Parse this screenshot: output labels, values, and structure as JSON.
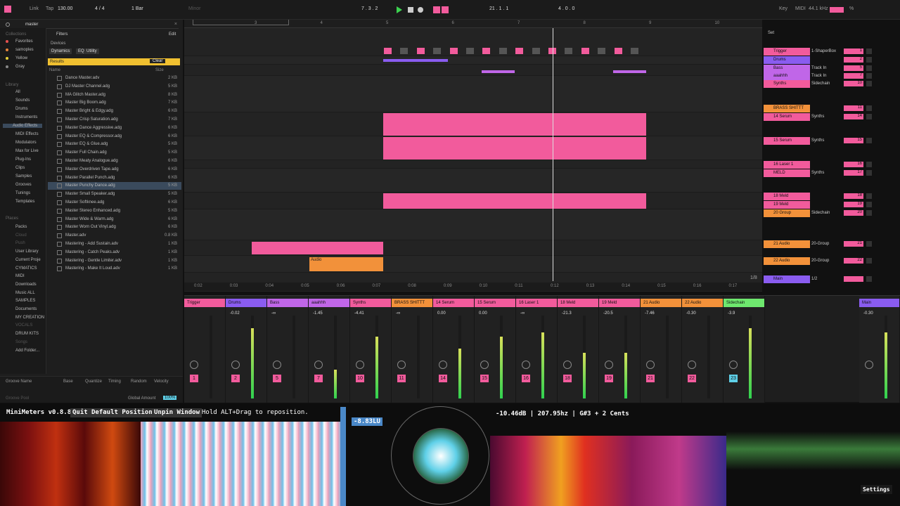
{
  "transport": {
    "link": "Link",
    "tap": "Tap",
    "tempo": "130.00",
    "signature": "4 / 4",
    "quantize": "1 Bar",
    "key_mode": "Minor",
    "position": "7 . 3 . 2",
    "loop_start": "21 . 1 . 1",
    "loop_length": "4 . 0 . 0",
    "key": "Key",
    "midi": "MIDI",
    "sample_rate": "44.1 kHz",
    "cpu": "%"
  },
  "browser": {
    "search": "master",
    "filters_label": "Filters",
    "edit_label": "Edit",
    "devices_label": "Devices",
    "tags": [
      "Dynamics",
      "EQ",
      "Utility"
    ],
    "results_label": "Results",
    "clear_label": "Clear",
    "col_name": "Name",
    "col_size": "Size",
    "collections_header": "Collections",
    "collections": [
      "Favorites",
      "samoples",
      "Yellow",
      "Gray"
    ],
    "collection_colors": [
      "#e85050",
      "#e8843a",
      "#e8d13a",
      "#888888"
    ],
    "library_header": "Library",
    "library": [
      "All",
      "Sounds",
      "Drums",
      "Instruments",
      "Audio Effects",
      "MIDI Effects",
      "Modulators",
      "Max for Live",
      "Plug-Ins",
      "Clips",
      "Samples",
      "Grooves",
      "Tunings",
      "Templates"
    ],
    "places_header": "Places",
    "places": [
      "Packs",
      "Cloud",
      "Push",
      "User Library",
      "Current Proje",
      "CYMATICS",
      "MIDI",
      "Downloads",
      "Music ALL",
      "SAMPLES",
      "Documents",
      "MY CREATION",
      "VOCALS",
      "DRUM KITS",
      "Songs",
      "Add Folder..."
    ],
    "files": [
      {
        "name": "Dance Master.adv",
        "size": "2 KB"
      },
      {
        "name": "DJ Master Channel.adg",
        "size": "5 KB"
      },
      {
        "name": "MA Glitch Master.adg",
        "size": "8 KB"
      },
      {
        "name": "Master Big Boom.adg",
        "size": "7 KB"
      },
      {
        "name": "Master Bright & Edgy.adg",
        "size": "6 KB"
      },
      {
        "name": "Master Crisp Saturation.adg",
        "size": "7 KB"
      },
      {
        "name": "Master Dance Aggressive.adg",
        "size": "6 KB"
      },
      {
        "name": "Master EQ & Compressor.adg",
        "size": "6 KB"
      },
      {
        "name": "Master EQ & Glue.adg",
        "size": "5 KB"
      },
      {
        "name": "Master Full Chain.adg",
        "size": "5 KB"
      },
      {
        "name": "Master Meaty Analogue.adg",
        "size": "6 KB"
      },
      {
        "name": "Master Overdriven Tape.adg",
        "size": "6 KB"
      },
      {
        "name": "Master Parallel Punch.adg",
        "size": "6 KB"
      },
      {
        "name": "Master Punchy Dance.adg",
        "size": "5 KB"
      },
      {
        "name": "Master Small Speaker.adg",
        "size": "5 KB"
      },
      {
        "name": "Master Softknee.adg",
        "size": "6 KB"
      },
      {
        "name": "Master Stereo Enhanced.adg",
        "size": "5 KB"
      },
      {
        "name": "Master Wide & Warm.adg",
        "size": "6 KB"
      },
      {
        "name": "Master Worn Out Vinyl.adg",
        "size": "6 KB"
      },
      {
        "name": "Master.adv",
        "size": "0.8 KB"
      },
      {
        "name": "Mastering - Add Sustain.adv",
        "size": "1 KB"
      },
      {
        "name": "Mastering - Catch Peaks.adv",
        "size": "1 KB"
      },
      {
        "name": "Mastering - Gentle Limiter.adv",
        "size": "1 KB"
      },
      {
        "name": "Mastering - Make It Loud.adv",
        "size": "1 KB"
      }
    ],
    "groove": {
      "name": "Groove Name",
      "base": "Base",
      "quantize": "Quantize",
      "timing": "Timing",
      "random": "Random",
      "velocity": "Velocity",
      "pool": "Groove Pool",
      "global_amount": "Global Amount",
      "global_value": "100%"
    }
  },
  "arrangement": {
    "bars": [
      "3",
      "4",
      "5",
      "6",
      "7",
      "8",
      "9",
      "10"
    ],
    "times": [
      "0:02",
      "0:03",
      "0:04",
      "0:05",
      "0:06",
      "0:07",
      "0:08",
      "0:09",
      "0:10",
      "0:11",
      "0:12",
      "0:13",
      "0:14",
      "0:15",
      "0:16",
      "0:17"
    ],
    "zoom": "1/8",
    "clip_audio": "Audio",
    "set_label": "Set"
  },
  "tracks": [
    {
      "name": "Trigger",
      "device": "1-ShaperBox",
      "num": "1",
      "color": "#f25b9c"
    },
    {
      "name": "Drums",
      "device": "",
      "num": "2",
      "color": "#8a5cf0"
    },
    {
      "name": "Bass",
      "device": "Track In",
      "num": "5",
      "color": "#c066e8"
    },
    {
      "name": "aaahhh",
      "device": "Track In",
      "num": "7",
      "color": "#c066e8"
    },
    {
      "name": "Synths",
      "device": "Sidechain",
      "num": "10",
      "color": "#f25b9c"
    },
    {
      "name": "BRASS SHITTT",
      "device": "",
      "num": "11",
      "color": "#f2913a"
    },
    {
      "name": "14 Serum",
      "device": "Synths",
      "num": "14",
      "color": "#f25b9c"
    },
    {
      "name": "15 Serum",
      "device": "Synths",
      "num": "15",
      "color": "#f25b9c"
    },
    {
      "name": "16 Laser 1",
      "device": "",
      "num": "16",
      "color": "#f25b9c"
    },
    {
      "name": "MELD",
      "device": "Synths",
      "num": "17",
      "color": "#f25b9c"
    },
    {
      "name": "18 Meld",
      "device": "",
      "num": "18",
      "color": "#f25b9c"
    },
    {
      "name": "19 Meld",
      "device": "",
      "num": "19",
      "color": "#f25b9c"
    },
    {
      "name": "20 Group",
      "device": "Sidechain",
      "num": "20",
      "color": "#f2913a"
    },
    {
      "name": "21 Audio",
      "device": "20-Group",
      "num": "21",
      "color": "#f2913a"
    },
    {
      "name": "22 Audio",
      "device": "20-Group",
      "num": "22",
      "color": "#f2913a"
    },
    {
      "name": "Main",
      "device": "1/2",
      "num": "",
      "color": "#8a5cf0"
    }
  ],
  "mixer": [
    {
      "name": "Trigger",
      "vol": "",
      "num": "1",
      "color": "#f25b9c",
      "level": 0
    },
    {
      "name": "Drums",
      "vol": "-0.02",
      "num": "2",
      "color": "#8a5cf0",
      "level": 0.85
    },
    {
      "name": "Bass",
      "vol": "-∞",
      "num": "5",
      "color": "#c066e8",
      "level": 0
    },
    {
      "name": "aaahhh",
      "vol": "-1.45",
      "num": "7",
      "color": "#c066e8",
      "level": 0.35
    },
    {
      "name": "Synths",
      "vol": "-4.41",
      "num": "10",
      "color": "#f25b9c",
      "level": 0.75
    },
    {
      "name": "BRASS SHITTT",
      "vol": "-∞",
      "num": "11",
      "color": "#f2913a",
      "level": 0
    },
    {
      "name": "14 Serum",
      "vol": "0.00",
      "num": "14",
      "color": "#f25b9c",
      "level": 0.6
    },
    {
      "name": "15 Serum",
      "vol": "0.00",
      "num": "15",
      "color": "#f25b9c",
      "level": 0.75
    },
    {
      "name": "16 Laser 1",
      "vol": "-∞",
      "num": "16",
      "color": "#f25b9c",
      "level": 0.8
    },
    {
      "name": "18 Meld",
      "vol": "-21.3",
      "num": "18",
      "color": "#f25b9c",
      "level": 0.55
    },
    {
      "name": "19 Meld",
      "vol": "-20.5",
      "num": "19",
      "color": "#f25b9c",
      "level": 0.55
    },
    {
      "name": "21 Audio",
      "vol": "-7.46",
      "num": "21",
      "color": "#f2913a",
      "level": 0
    },
    {
      "name": "22 Audio",
      "vol": "-0.30",
      "num": "22",
      "color": "#f2913a",
      "level": 0
    },
    {
      "name": "Sidechain",
      "vol": "-3.9",
      "num": "23",
      "color": "#6ee86e",
      "level": 0.85
    },
    {
      "name": "Main",
      "vol": "-0.30",
      "num": "",
      "color": "#8a5cf0",
      "level": 0.8
    }
  ],
  "minimeters": {
    "title": "MiniMeters v0.8.8",
    "quit": "Quit",
    "default_position": "Default Position",
    "unpin": "Unpin Window",
    "hint": "Hold ALT+Drag to reposition.",
    "lufs": "-8.83LU",
    "readout": "-10.46dB | 207.95hz | G#3 + 2 Cents",
    "settings": "Settings"
  },
  "colors": {
    "pink": "#f25b9c",
    "purple": "#8a5cf0",
    "orange": "#f2913a",
    "yellow": "#f0c030",
    "cyan": "#5fd0e8"
  }
}
